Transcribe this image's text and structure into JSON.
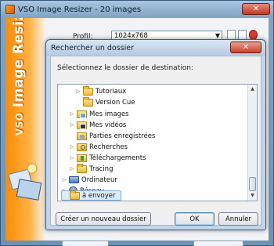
{
  "app": {
    "title": "VSO Image Resizer - 20 images",
    "close_glyph": "✕",
    "brand_vso": "VSO",
    "brand_name": "Image Resizer",
    "profil_label": "Profil:",
    "profil_value": "1024x768",
    "accent_color": "#ff8a00"
  },
  "dialog": {
    "title": "Rechercher un dossier",
    "close_glyph": "✕",
    "instruction": "Sélectionnez le dossier de destination:",
    "tree_items": [
      {
        "label": "Tutoriaux",
        "icon": "folder-icon",
        "expander": "▷"
      },
      {
        "label": "Version Cue",
        "icon": "folder-icon",
        "expander": ""
      },
      {
        "label": "Mes images",
        "icon": "pictures-folder-icon",
        "expander": "▷"
      },
      {
        "label": "Mes vidéos",
        "icon": "videos-folder-icon",
        "expander": "▷"
      },
      {
        "label": "Parties enregistrées",
        "icon": "saved-games-folder-icon",
        "expander": ""
      },
      {
        "label": "Recherches",
        "icon": "searches-folder-icon",
        "expander": "▷"
      },
      {
        "label": "Téléchargements",
        "icon": "downloads-folder-icon",
        "expander": "▷"
      },
      {
        "label": "Tracing",
        "icon": "folder-icon",
        "expander": "▷"
      },
      {
        "label": "Ordinateur",
        "icon": "computer-icon",
        "expander": "▷"
      },
      {
        "label": "Réseau",
        "icon": "network-icon",
        "expander": "▷"
      },
      {
        "label": "à envoyer",
        "icon": "folder-icon",
        "expander": "",
        "selected": true
      }
    ],
    "new_folder_button": "Créer un nouveau dossier",
    "ok_button": "OK",
    "cancel_button": "Annuler"
  }
}
